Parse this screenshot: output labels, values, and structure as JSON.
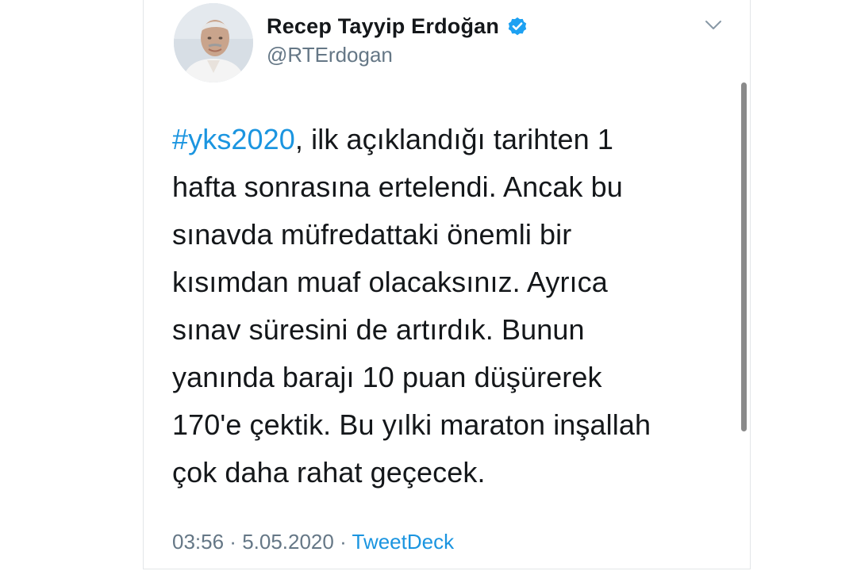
{
  "author": {
    "display_name": "Recep Tayyip Erdoğan",
    "handle": "@RTErdogan",
    "verified_icon": "verified-badge-icon"
  },
  "tweet": {
    "hashtag": "#yks2020",
    "lines": [
      ", ilk açıklandığı tarihten 1",
      "hafta sonrasına ertelendi. Ancak bu",
      "sınavda müfredattaki önemli bir",
      "kısımdan muaf olacaksınız. Ayrıca",
      "sınav süresini de artırdık. Bunun",
      "yanında barajı 10 puan düşürerek",
      "170'e çektik. Bu yılki maraton inşallah",
      "çok daha rahat geçecek."
    ]
  },
  "meta": {
    "time": "03:56",
    "separator": " · ",
    "date": "5.05.2020",
    "source": "TweetDeck"
  },
  "icons": {
    "menu": "chevron-down-icon"
  },
  "colors": {
    "link": "#1b95e0",
    "text": "#14171a",
    "secondary": "#657786",
    "verified": "#1da1f2"
  }
}
